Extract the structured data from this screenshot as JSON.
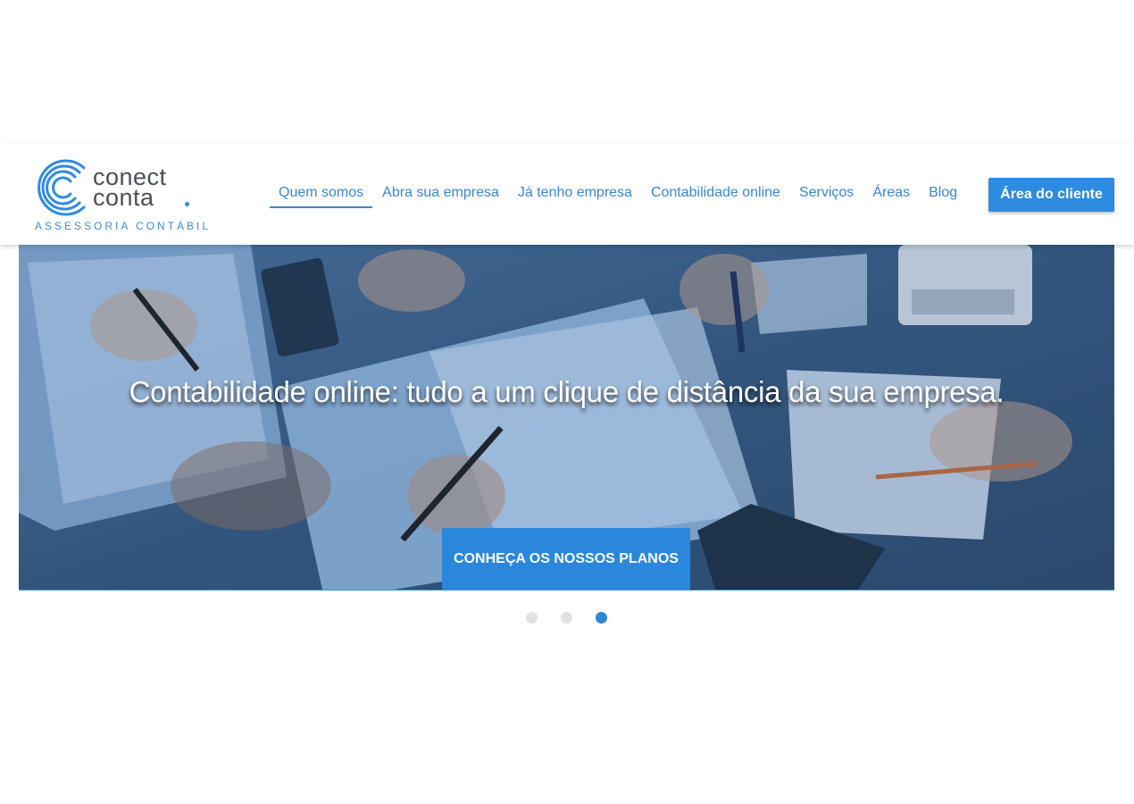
{
  "brand": {
    "name_line1": "conect",
    "name_line2": "conta",
    "tagline": "ASSESSORIA CONTÁBIL",
    "accent_color": "#2d8be0"
  },
  "nav": {
    "items": [
      {
        "label": "Quem somos",
        "active": true
      },
      {
        "label": "Abra sua empresa",
        "active": false
      },
      {
        "label": "Já tenho empresa",
        "active": false
      },
      {
        "label": "Contabilidade online",
        "active": false
      },
      {
        "label": "Serviços",
        "active": false
      },
      {
        "label": "Áreas",
        "active": false
      },
      {
        "label": "Blog",
        "active": false
      }
    ],
    "cta_label": "Área do cliente"
  },
  "hero": {
    "headline": "Contabilidade online: tudo a um clique de distância da sua empresa.",
    "button_label": "CONHEÇA OS NOSSOS PLANOS",
    "image_description_icon": "office-desk-photo"
  },
  "carousel": {
    "slide_count": 3,
    "active_slide": 3
  }
}
